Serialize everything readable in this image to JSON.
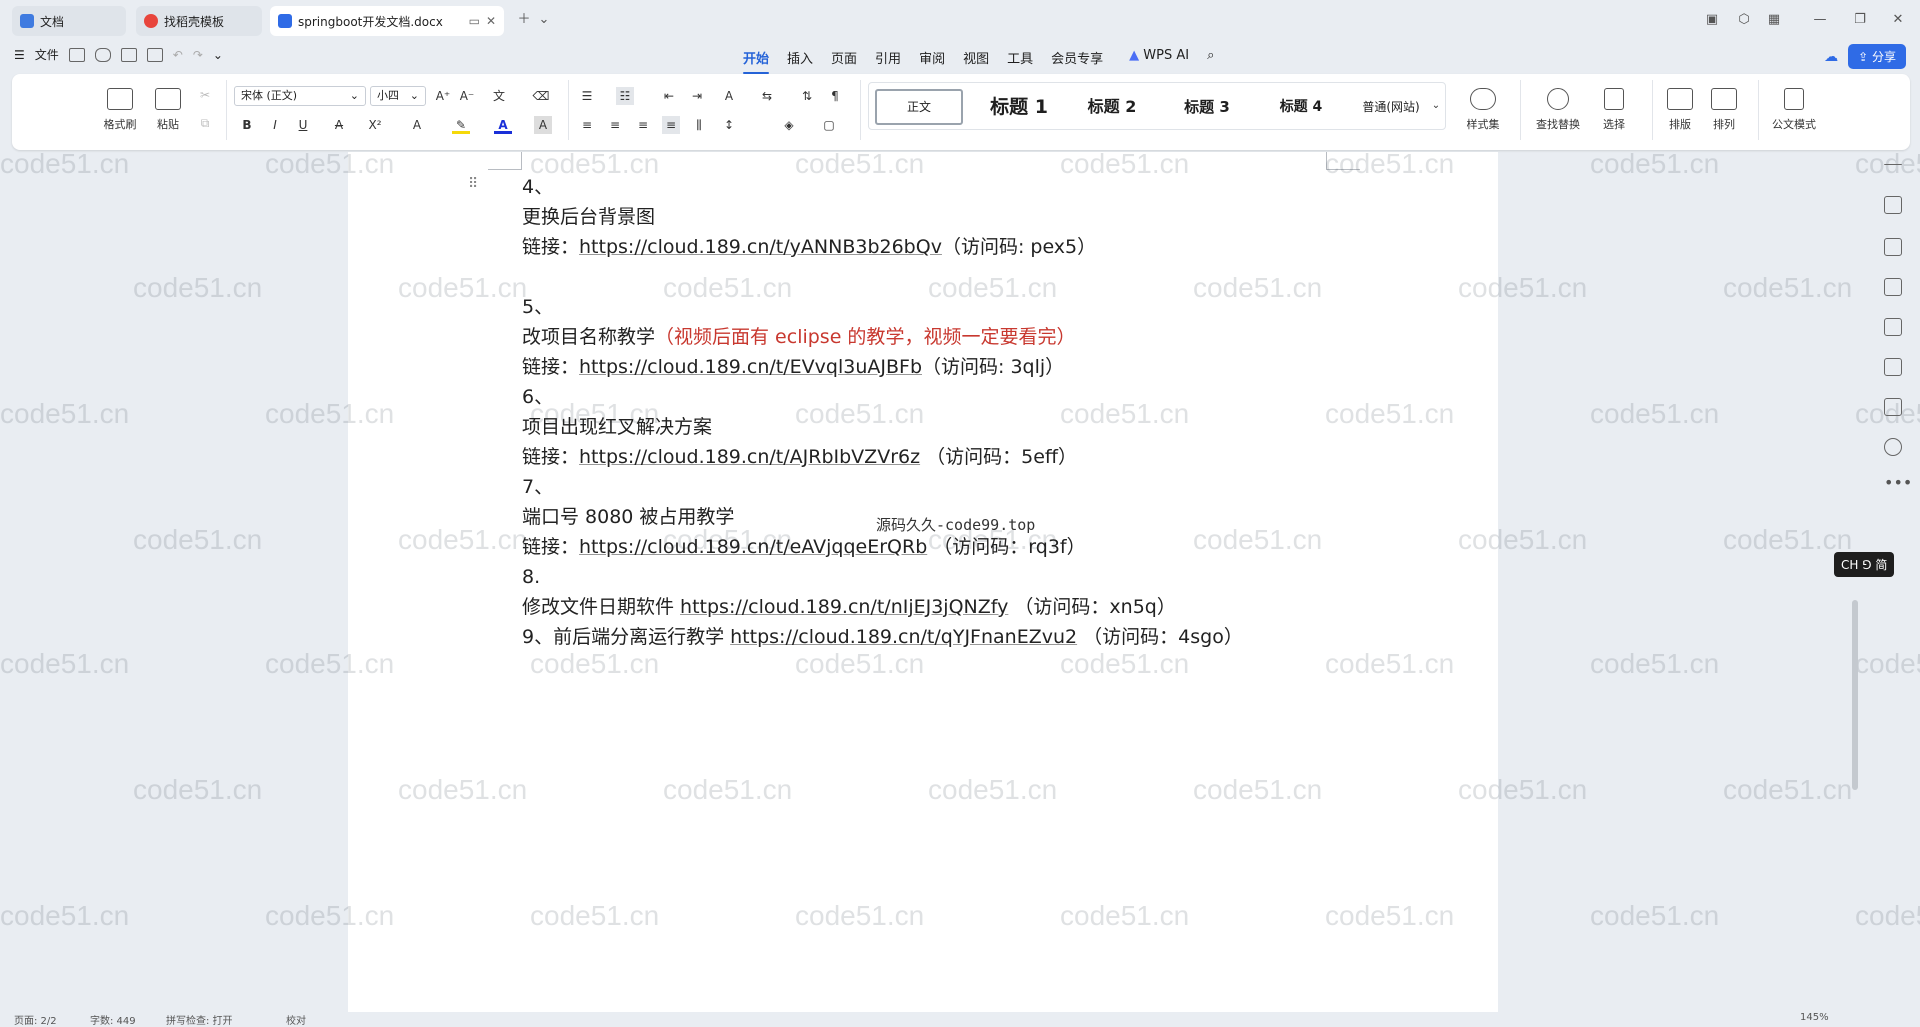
{
  "tabs": [
    {
      "label": "文档",
      "icon": "docs-icon"
    },
    {
      "label": "找稻壳模板",
      "icon": "template-icon"
    },
    {
      "label": "springboot开发文档.docx",
      "icon": "word-doc-icon"
    }
  ],
  "menu": {
    "file_label": "文件",
    "tabs": [
      "开始",
      "插入",
      "页面",
      "引用",
      "审阅",
      "视图",
      "工具",
      "会员专享"
    ],
    "selected_tab": "开始",
    "wps_ai": "WPS AI",
    "share": "分享"
  },
  "ribbon": {
    "format_painter": "格式刷",
    "paste": "粘贴",
    "font": "宋体 (正文)",
    "size": "小四",
    "styles": [
      "正文",
      "标题 1",
      "标题 2",
      "标题 3",
      "标题 4",
      "普通(网站)"
    ],
    "style_set": "样式集",
    "find_replace": "查找替换",
    "select": "选择",
    "layout": "排版",
    "arrange": "排列",
    "official": "公文模式"
  },
  "document": {
    "lines": [
      {
        "text": "4、"
      },
      {
        "text": "更换后台背景图"
      },
      {
        "prefix": "链接：",
        "link": "https://cloud.189.cn/t/yANNB3b26bQv",
        "suffix": "（访问码: pex5）"
      },
      {
        "blank": true
      },
      {
        "text": "5、"
      },
      {
        "text": "改项目名称教学",
        "red": "（视频后面有 eclipse 的教学，视频一定要看完）"
      },
      {
        "prefix": "链接：",
        "link": "https://cloud.189.cn/t/EVvql3uAJBFb",
        "suffix": "（访问码: 3qlj）"
      },
      {
        "text": "6、"
      },
      {
        "text": "项目出现红叉解决方案"
      },
      {
        "prefix": "链接：",
        "link": "https://cloud.189.cn/t/AJRbIbVZVr6z",
        "suffix": " （访问码：5eff）"
      },
      {
        "text": "7、"
      },
      {
        "text": "端口号 8080 被占用教学"
      },
      {
        "prefix": "链接：",
        "link": "https://cloud.189.cn/t/eAVjqqeErQRb",
        "suffix": " （访问码：rq3f）"
      },
      {
        "text": "8."
      },
      {
        "prefix": "修改文件日期软件 ",
        "link": "https://cloud.189.cn/t/nIjEJ3jQNZfy",
        "suffix": " （访问码：xn5q）"
      },
      {
        "prefix": "9、前后端分离运行教学 ",
        "link": "https://cloud.189.cn/t/qYJFnanEZvu2",
        "suffix": " （访问码：4sgo）"
      }
    ],
    "inline_watermark": "源码久久-code99.top"
  },
  "watermark_text": "code51.cn",
  "ime_label": "CH ⅁ 简",
  "status": {
    "page": "页面: 2/2",
    "words": "字数: 449",
    "spell": "拼写检查: 打开",
    "proof": "校对",
    "zoom": "145%"
  }
}
